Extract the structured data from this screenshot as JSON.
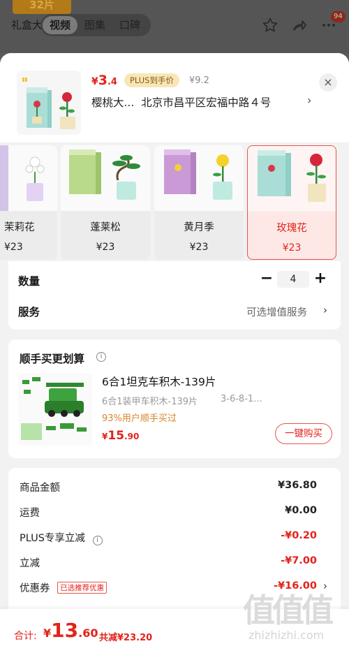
{
  "top": {
    "badge": "32片",
    "title_fragment": "礼盒大",
    "tabs": [
      "视频",
      "图集",
      "口碑"
    ],
    "active_tab": "视频",
    "cart_count": "94"
  },
  "header": {
    "price_currency": "¥",
    "price_int": "3",
    "price_dec": ".4",
    "plus_tag": "PLUS到手价",
    "plus_price": "¥9.2",
    "address_name": "樱桃大...",
    "address": "北京市昌平区宏福中路４号",
    "close": "×"
  },
  "variants": [
    {
      "name": "茉莉花",
      "price": "¥23",
      "selected": false
    },
    {
      "name": "蓬莱松",
      "price": "¥23",
      "selected": false
    },
    {
      "name": "黄月季",
      "price": "¥23",
      "selected": false
    },
    {
      "name": "玫瑰花",
      "price": "¥23",
      "selected": true
    }
  ],
  "quantity": {
    "label": "数量",
    "value": "4",
    "minus": "−",
    "plus": "+"
  },
  "service": {
    "label": "服务",
    "value": "可选增值服务"
  },
  "bundle": {
    "title": "顺手买更划算",
    "product_name": "6合1坦克车积木-139片",
    "sub1": "6合1装甲车积木-139片",
    "sub2": "3-6-8-1...",
    "social": "93%用户顺手买过",
    "price_currency": "¥",
    "price_int": "15",
    "price_dec": ".90",
    "buy_label": "一键购买"
  },
  "summary": {
    "goods_label": "商品金额",
    "goods_value": "¥36.80",
    "shipping_label": "运费",
    "shipping_value": "¥0.00",
    "plus_label": "PLUS专享立减",
    "plus_value": "-¥0.20",
    "discount_label": "立减",
    "discount_value": "-¥7.00",
    "coupon_label": "优惠券",
    "coupon_tag": "已选推荐优惠",
    "coupon_value": "-¥16.00"
  },
  "bottom": {
    "total_label": "合计:",
    "total_currency": "¥",
    "total_int": "13",
    "total_dec": ".60",
    "saved": "共减¥23.20"
  },
  "watermark": {
    "glyphs": "值值值",
    "url": "zhizhizhi.com"
  },
  "colors": {
    "accent": "#e2231a",
    "plus_gold": "#f7e7b8",
    "social": "#d4862a"
  }
}
